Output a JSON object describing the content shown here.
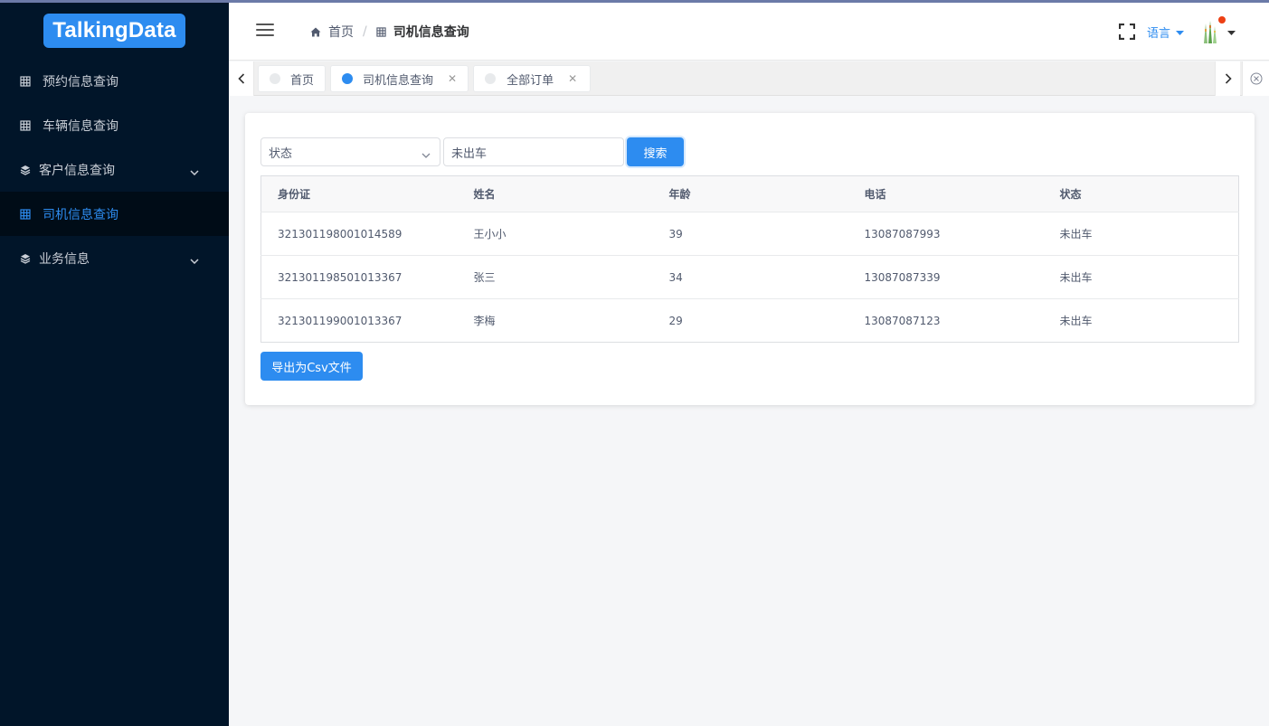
{
  "brand": {
    "logo_text": "TalkingData"
  },
  "sidebar": {
    "items": [
      {
        "label": "预约信息查询",
        "icon": "grid-icon",
        "expandable": false,
        "active": false
      },
      {
        "label": "车辆信息查询",
        "icon": "grid-icon",
        "expandable": false,
        "active": false
      },
      {
        "label": "客户信息查询",
        "icon": "layers-icon",
        "expandable": true,
        "active": false
      },
      {
        "label": "司机信息查询",
        "icon": "grid-icon",
        "expandable": false,
        "active": true
      },
      {
        "label": "业务信息",
        "icon": "layers-icon",
        "expandable": true,
        "active": false
      }
    ]
  },
  "header": {
    "breadcrumb": [
      {
        "label": "首页",
        "icon": "home-icon"
      },
      {
        "label": "司机信息查询",
        "icon": "grid-icon"
      }
    ],
    "language_label": "语言",
    "has_notification": true
  },
  "tabs": [
    {
      "label": "首页",
      "active": false,
      "closable": false
    },
    {
      "label": "司机信息查询",
      "active": true,
      "closable": true
    },
    {
      "label": "全部订单",
      "active": false,
      "closable": true
    }
  ],
  "filters": {
    "select_value": "状态",
    "input_value": "未出车",
    "search_label": "搜索"
  },
  "table": {
    "columns": [
      "身份证",
      "姓名",
      "年龄",
      "电话",
      "状态"
    ],
    "rows": [
      [
        "321301198001014589",
        "王小小",
        "39",
        "13087087993",
        "未出车"
      ],
      [
        "321301198501013367",
        "张三",
        "34",
        "13087087339",
        "未出车"
      ],
      [
        "321301199001013367",
        "李梅",
        "29",
        "13087087123",
        "未出车"
      ]
    ]
  },
  "export_label": "导出为Csv文件",
  "colors": {
    "sidebar_bg": "#011529",
    "accent": "#2d8cf0",
    "notification": "#ed4014"
  }
}
